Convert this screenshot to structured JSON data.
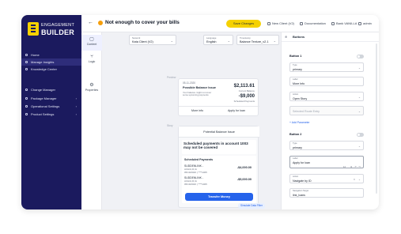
{
  "brand": {
    "line1": "ENGAGEMENT",
    "line2": "BUILDER"
  },
  "sidebar": {
    "items": [
      {
        "label": "Home",
        "chevron": ""
      },
      {
        "label": "Manage Insights",
        "chevron": ""
      },
      {
        "label": "Knowledge Center",
        "chevron": ""
      },
      {
        "label": "Change Manager",
        "chevron": ""
      },
      {
        "label": "Package Manager",
        "chevron": "›"
      },
      {
        "label": "Operational Settings",
        "chevron": "›"
      },
      {
        "label": "Product Settings",
        "chevron": "›"
      }
    ]
  },
  "topbar": {
    "back": "←",
    "title": "Not enough to cover your bills",
    "title_chevron": "⌄",
    "save_label": "Save Changes",
    "client_label": "New Client (V2)",
    "documentation_label": "Documentation",
    "bank_label": "Bank VANILLA",
    "admin_label": "admin"
  },
  "tools": [
    {
      "glyph": "▢",
      "label": "Content"
    },
    {
      "glyph": "⑂",
      "label": "Logic"
    },
    {
      "glyph": "⚙",
      "label": "Properties"
    }
  ],
  "selectors": {
    "network": {
      "label": "Network",
      "value": "Kata Client (V2)"
    },
    "language": {
      "label": "Language",
      "value": "English"
    },
    "timestamp": {
      "label": "Timestamp",
      "value": "Balance Texture_v2.1"
    }
  },
  "preview": {
    "section_label": "Preview",
    "mini_card": {
      "date": "05-11-2020",
      "title": "Possible Balance Issue",
      "desc": "Your balance might not cover some upcoming payments",
      "amount1": "$2,113.61",
      "amount1_label": "Current Balance",
      "amount2": "-$9,000",
      "amount2_label": "Scheduled Payments",
      "btn1": "More info",
      "btn2": "Apply for loan"
    },
    "detail_section_label": "Story",
    "detail": {
      "header": "Potential Balance Issue",
      "headline": "Scheduled payments in account 1003 may not be covered",
      "subhead": "Scheduled Payments",
      "payments": [
        {
          "name": "SUDDENLINK -",
          "desc": "ACH/A,R,IA",
          "date": "05/19/2020 | ****1005",
          "amount": "-$4,000.00"
        },
        {
          "name": "SUDDENLINK -",
          "desc": "ACH/A,R,IA",
          "date": "05/19/2020 | ****1005",
          "amount": "-$5,000.00"
        }
      ],
      "cta": "Transfer Money"
    },
    "simulate_label": "Simulate Data Filter"
  },
  "panel": {
    "header": "Buttons",
    "button1": {
      "title": "Button 1",
      "type_label": "Type",
      "type_value": "primary",
      "label_label": "Label",
      "label_value": "More Info",
      "action_label": "Action",
      "action_value": "Open Story",
      "entry_label": "Selected Route Entry"
    },
    "add_param": "+ Add Parameter",
    "button2": {
      "title": "Button 2",
      "type_label": "Type",
      "type_value": "primary",
      "label_label": "Label",
      "label_value": "Apply for loan",
      "label_counter": "14",
      "action_label": "Action",
      "action_value": "Navigate by ID",
      "nav_label": "Navigation Target",
      "nav_value": "link_loans"
    }
  }
}
